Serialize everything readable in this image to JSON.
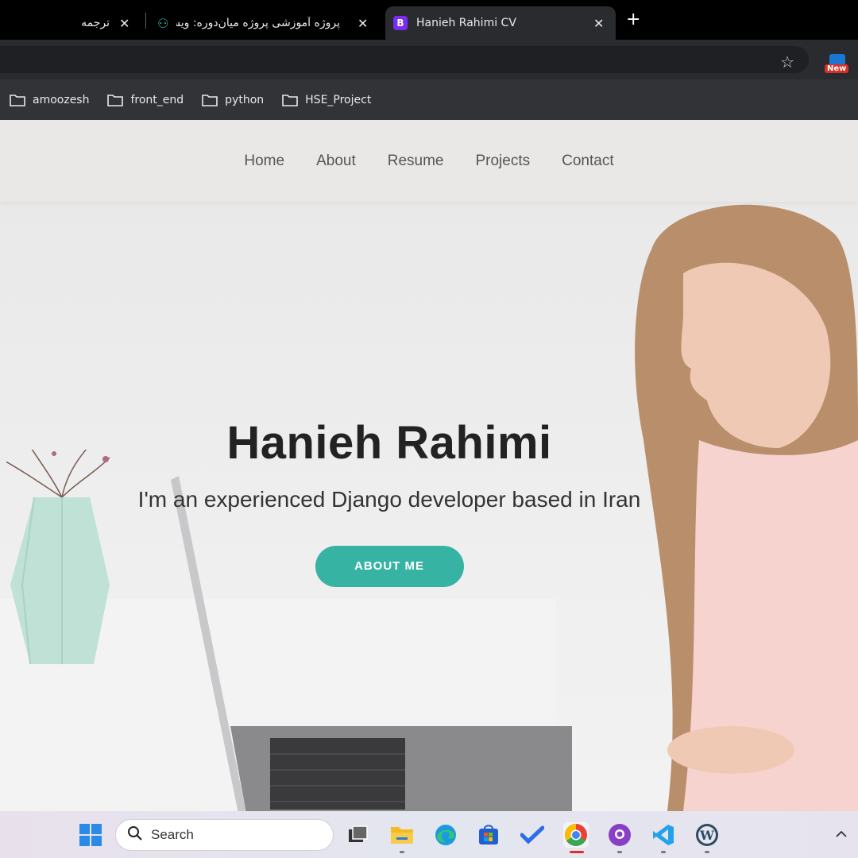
{
  "browser": {
    "tabs": [
      {
        "label": "ترجمه"
      },
      {
        "label": "پروژه آموزشی پروژه میان‌دوره: ویسا"
      },
      {
        "label": "Hanieh Rahimi CV",
        "favicon": "B",
        "active": true
      }
    ],
    "close_glyph": "✕",
    "newtab_glyph": "+",
    "extension_badge": "New",
    "star_glyph": "☆"
  },
  "bookmarks": [
    {
      "label": "amoozesh"
    },
    {
      "label": "front_end"
    },
    {
      "label": "python"
    },
    {
      "label": "HSE_Project"
    }
  ],
  "site": {
    "nav": [
      "Home",
      "About",
      "Resume",
      "Projects",
      "Contact"
    ],
    "hero": {
      "name": "Hanieh Rahimi",
      "subtitle": "I'm an experienced Django developer based in Iran",
      "button": "ABOUT ME"
    }
  },
  "taskbar": {
    "search_placeholder": "Search",
    "icons": [
      "windows-start-icon",
      "task-view-icon",
      "file-explorer-icon",
      "edge-icon",
      "store-icon",
      "todo-icon",
      "chrome-icon",
      "github-desktop-icon",
      "vscode-icon",
      "wordpress-icon"
    ],
    "chevron": "^"
  }
}
